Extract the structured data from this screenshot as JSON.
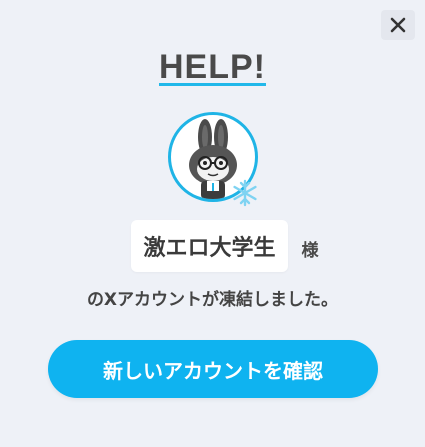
{
  "dialog": {
    "title": "HELP!",
    "name": "激エロ大学生",
    "honorific": "様",
    "message": "のXアカウントが凍結しました。",
    "cta_label": "新しいアカウントを確認",
    "close_icon": "close-icon",
    "avatar_icon": "bunny-avatar",
    "badge_icon": "snowflake-icon"
  },
  "colors": {
    "accent": "#0fb3f0",
    "ring": "#1fb4e6",
    "background": "#eef1f7"
  }
}
